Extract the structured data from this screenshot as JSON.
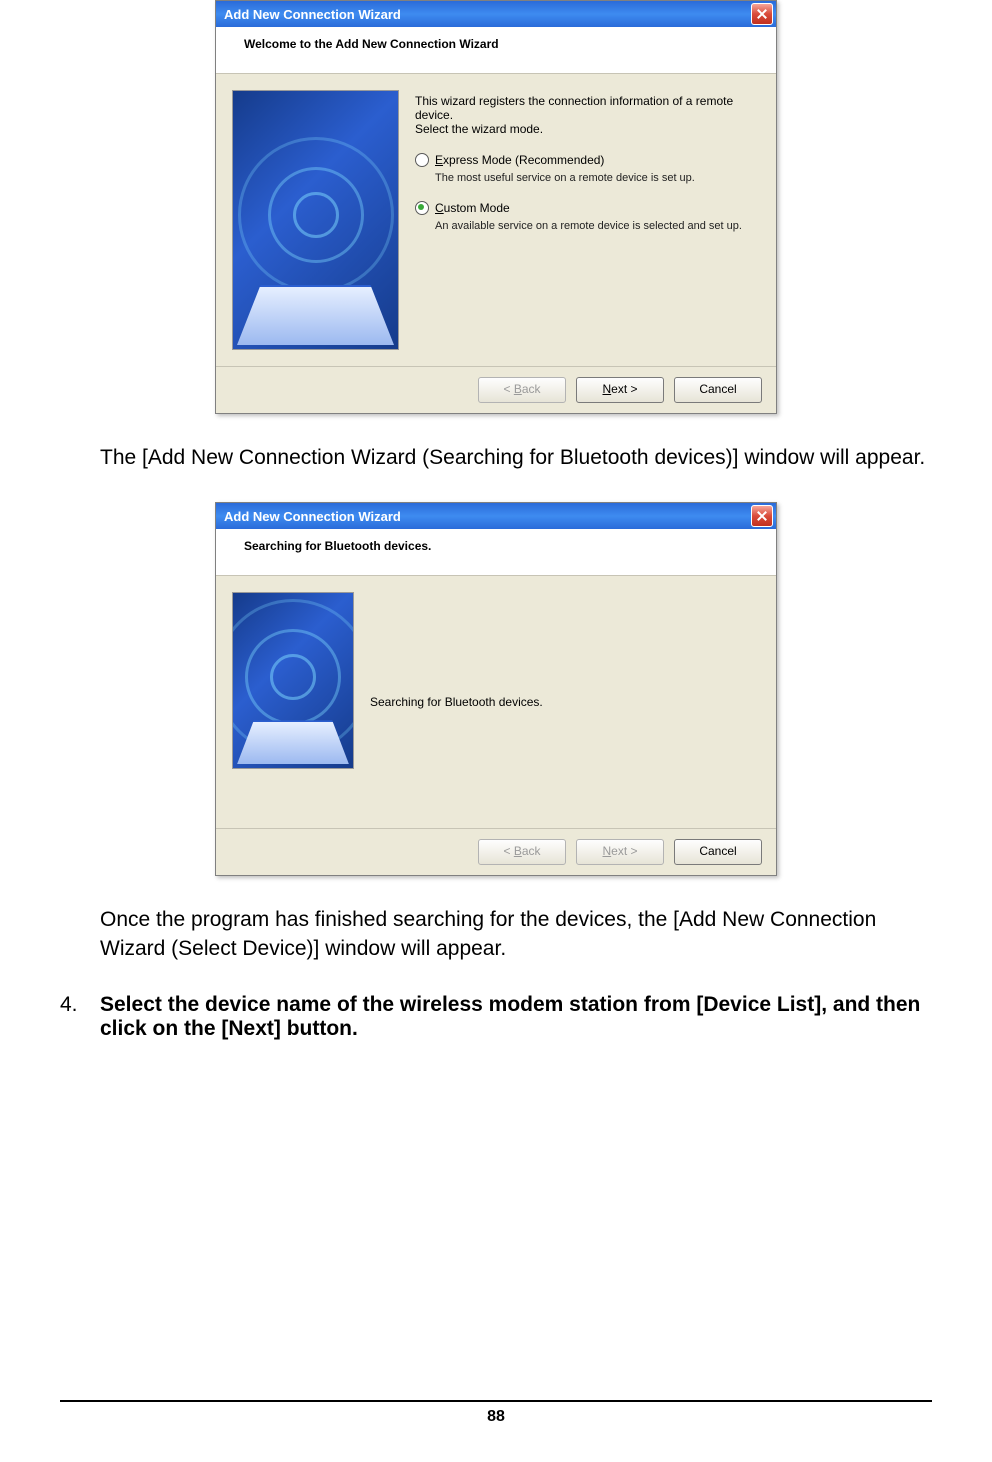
{
  "dialog1": {
    "title": "Add New Connection Wizard",
    "heading": "Welcome to the Add New Connection Wizard",
    "intro_line1": "This wizard registers the connection information of a remote device.",
    "intro_line2": "Select the wizard mode.",
    "option1": {
      "prefix": "E",
      "rest": "xpress Mode (Recommended)",
      "desc": "The most useful service on a remote device is set up.",
      "selected": false
    },
    "option2": {
      "prefix": "C",
      "rest": "ustom Mode",
      "desc": "An available service on a remote device is selected and set up.",
      "selected": true
    },
    "buttons": {
      "back_prefix": "< ",
      "back_ul": "B",
      "back_rest": "ack",
      "next_ul": "N",
      "next_rest": "ext >",
      "cancel": "Cancel"
    }
  },
  "doc": {
    "para1": "The [Add New Connection Wizard (Searching for Bluetooth devices)] window will appear.",
    "para2": "Once the program has finished searching for the devices, the [Add New Connection Wizard (Select Device)] window will appear.",
    "step_num": "4.",
    "step_text": "Select the device name of the wireless modem station from [Device List], and then click on the [Next] button.",
    "page_number": "88"
  },
  "dialog2": {
    "title": "Add New Connection Wizard",
    "heading": "Searching for Bluetooth devices.",
    "message": "Searching for Bluetooth devices.",
    "buttons": {
      "back_prefix": "< ",
      "back_ul": "B",
      "back_rest": "ack",
      "next_ul": "N",
      "next_rest": "ext >",
      "cancel": "Cancel"
    }
  }
}
